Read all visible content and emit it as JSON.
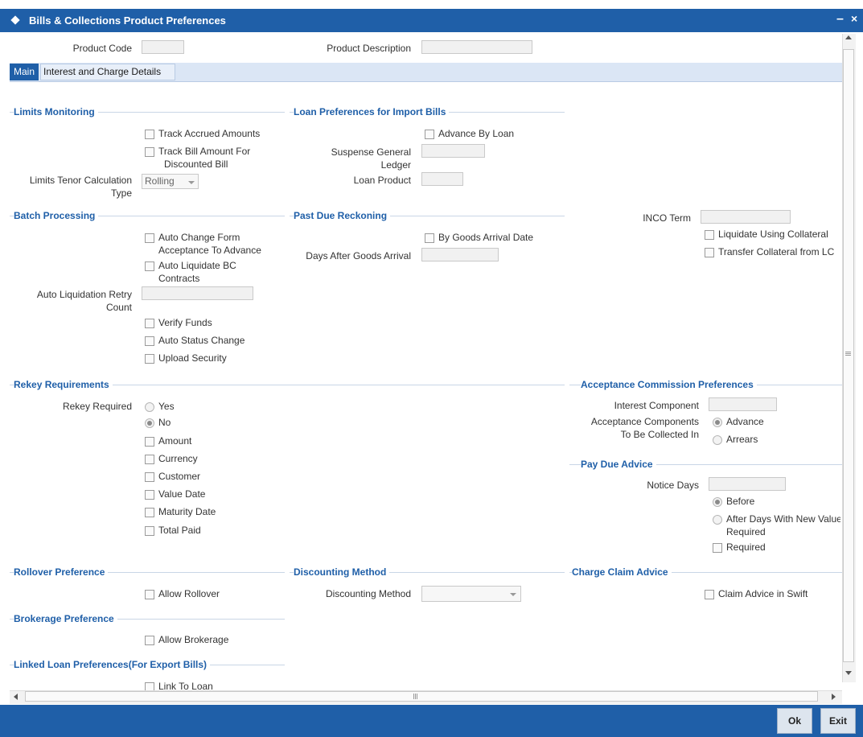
{
  "window": {
    "title": "Bills & Collections Product Preferences",
    "minimize": "–",
    "close": "×"
  },
  "header": {
    "product_code_label": "Product Code",
    "product_code_value": "",
    "product_description_label": "Product Description",
    "product_description_value": ""
  },
  "tabs": {
    "main": "Main",
    "interest": "Interest and Charge Details"
  },
  "limits": {
    "title": "Limits Monitoring",
    "track_accrued": "Track Accrued Amounts",
    "track_bill_1": "Track Bill Amount For",
    "track_bill_2": "Discounted Bill",
    "tenor_label_1": "Limits Tenor Calculation",
    "tenor_label_2": "Type",
    "tenor_value": "Rolling"
  },
  "loan_import": {
    "title": "Loan Preferences for Import Bills",
    "advance_by_loan": "Advance By Loan",
    "suspense_1": "Suspense General",
    "suspense_2": "Ledger",
    "loan_product": "Loan Product"
  },
  "batch": {
    "title": "Batch Processing",
    "auto_change_1": "Auto Change Form",
    "auto_change_2": "Acceptance To Advance",
    "auto_liq_1": "Auto Liquidate BC",
    "auto_liq_2": "Contracts",
    "retry_1": "Auto Liquidation Retry",
    "retry_2": "Count",
    "verify_funds": "Verify Funds",
    "auto_status": "Auto Status Change",
    "upload_security": "Upload Security"
  },
  "past_due": {
    "title": "Past Due Reckoning",
    "by_goods": "By Goods Arrival Date",
    "days_after": "Days After Goods Arrival"
  },
  "inco": {
    "label": "INCO Term",
    "liquidate_collateral": "Liquidate Using Collateral",
    "transfer_collateral": "Transfer Collateral from LC"
  },
  "rekey": {
    "title": "Rekey Requirements",
    "required_label": "Rekey Required",
    "yes": "Yes",
    "no": "No",
    "amount": "Amount",
    "currency": "Currency",
    "customer": "Customer",
    "value_date": "Value Date",
    "maturity_date": "Maturity Date",
    "total_paid": "Total Paid"
  },
  "acceptance": {
    "title": "Acceptance Commission Preferences",
    "interest_component": "Interest Component",
    "components_1": "Acceptance Components",
    "components_2": "To Be Collected In",
    "advance": "Advance",
    "arrears": "Arrears"
  },
  "pay_due": {
    "title": "Pay Due Advice",
    "notice_days": "Notice Days",
    "before": "Before",
    "after_1": "After Days With New Value",
    "after_2": "Required",
    "required": "Required"
  },
  "rollover": {
    "title": "Rollover Preference",
    "allow": "Allow Rollover"
  },
  "discounting": {
    "title": "Discounting Method",
    "label": "Discounting Method",
    "value": ""
  },
  "charge_claim": {
    "title": "Charge Claim Advice",
    "swift": "Claim Advice in Swift"
  },
  "brokerage": {
    "title": "Brokerage Preference",
    "allow": "Allow Brokerage"
  },
  "linked_loan": {
    "title": "Linked Loan Preferences(For Export Bills)",
    "link": "Link To Loan"
  },
  "footer": {
    "ok": "Ok",
    "exit": "Exit"
  },
  "colors": {
    "accent": "#1f5fa8",
    "tab_strip": "#dbe6f5"
  }
}
